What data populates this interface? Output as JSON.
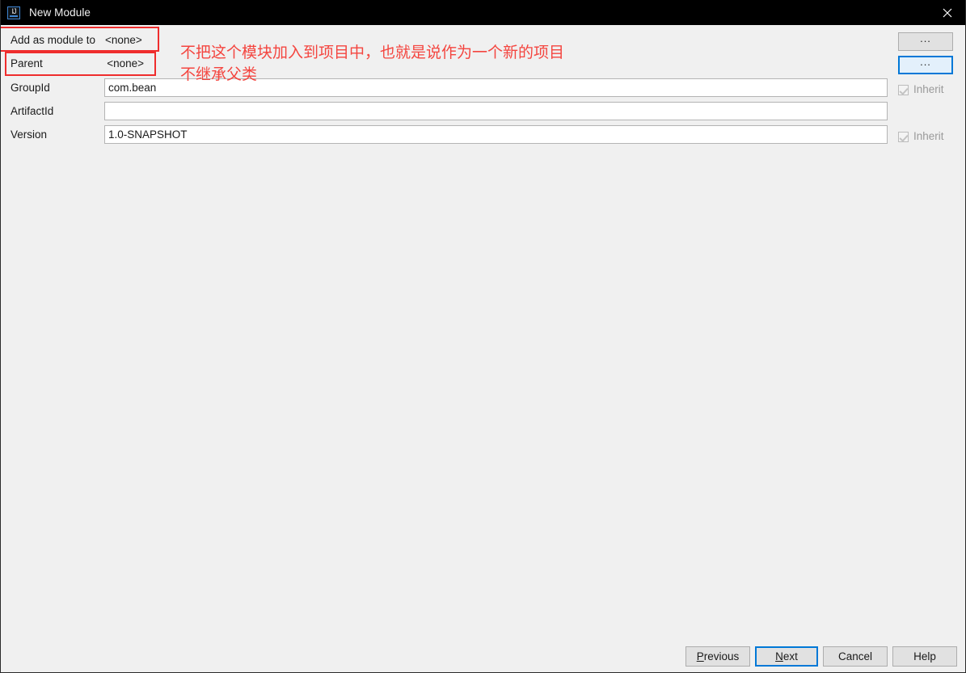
{
  "window": {
    "title": "New Module",
    "app_icon": "intellij-idea-icon",
    "icon_text": "IJ",
    "close_icon": "close-icon",
    "background_color": "#f0f0f0",
    "titlebar_color": "#000000"
  },
  "form": {
    "rows": [
      {
        "label": "Add as module to",
        "value": "<none>"
      },
      {
        "label": "Parent",
        "value": "<none>"
      }
    ],
    "fields": [
      {
        "label": "GroupId",
        "value": "com.bean",
        "placeholder": "",
        "inherit_label": "Inherit",
        "has_inherit": true
      },
      {
        "label": "ArtifactId",
        "value": "",
        "placeholder": "",
        "inherit_label": "",
        "has_inherit": false
      },
      {
        "label": "Version",
        "value": "1.0-SNAPSHOT",
        "placeholder": "",
        "inherit_label": "Inherit",
        "has_inherit": true
      }
    ],
    "browse_buttons": [
      {
        "label": "...",
        "name": "browse-module-button",
        "focused": false
      },
      {
        "label": "...",
        "name": "browse-parent-button",
        "focused": true
      }
    ]
  },
  "annotations": {
    "line1": "不把这个模块加入到项目中，也就是说作为一个新的项目",
    "line2": "不继承父类",
    "color": "#f4453f"
  },
  "footer": {
    "buttons": [
      {
        "label": "Previous",
        "mnemonic": "P",
        "name": "previous-button",
        "focused": false
      },
      {
        "label": "Next",
        "mnemonic": "N",
        "name": "next-button",
        "focused": true
      },
      {
        "label": "Cancel",
        "mnemonic": "",
        "name": "cancel-button",
        "focused": false
      },
      {
        "label": "Help",
        "mnemonic": "",
        "name": "help-button",
        "focused": false
      }
    ]
  },
  "colors": {
    "accent": "#0078d7",
    "annotation_red": "#f4453f",
    "button_face": "#e1e1e1",
    "field_border": "#b4b4b4"
  }
}
